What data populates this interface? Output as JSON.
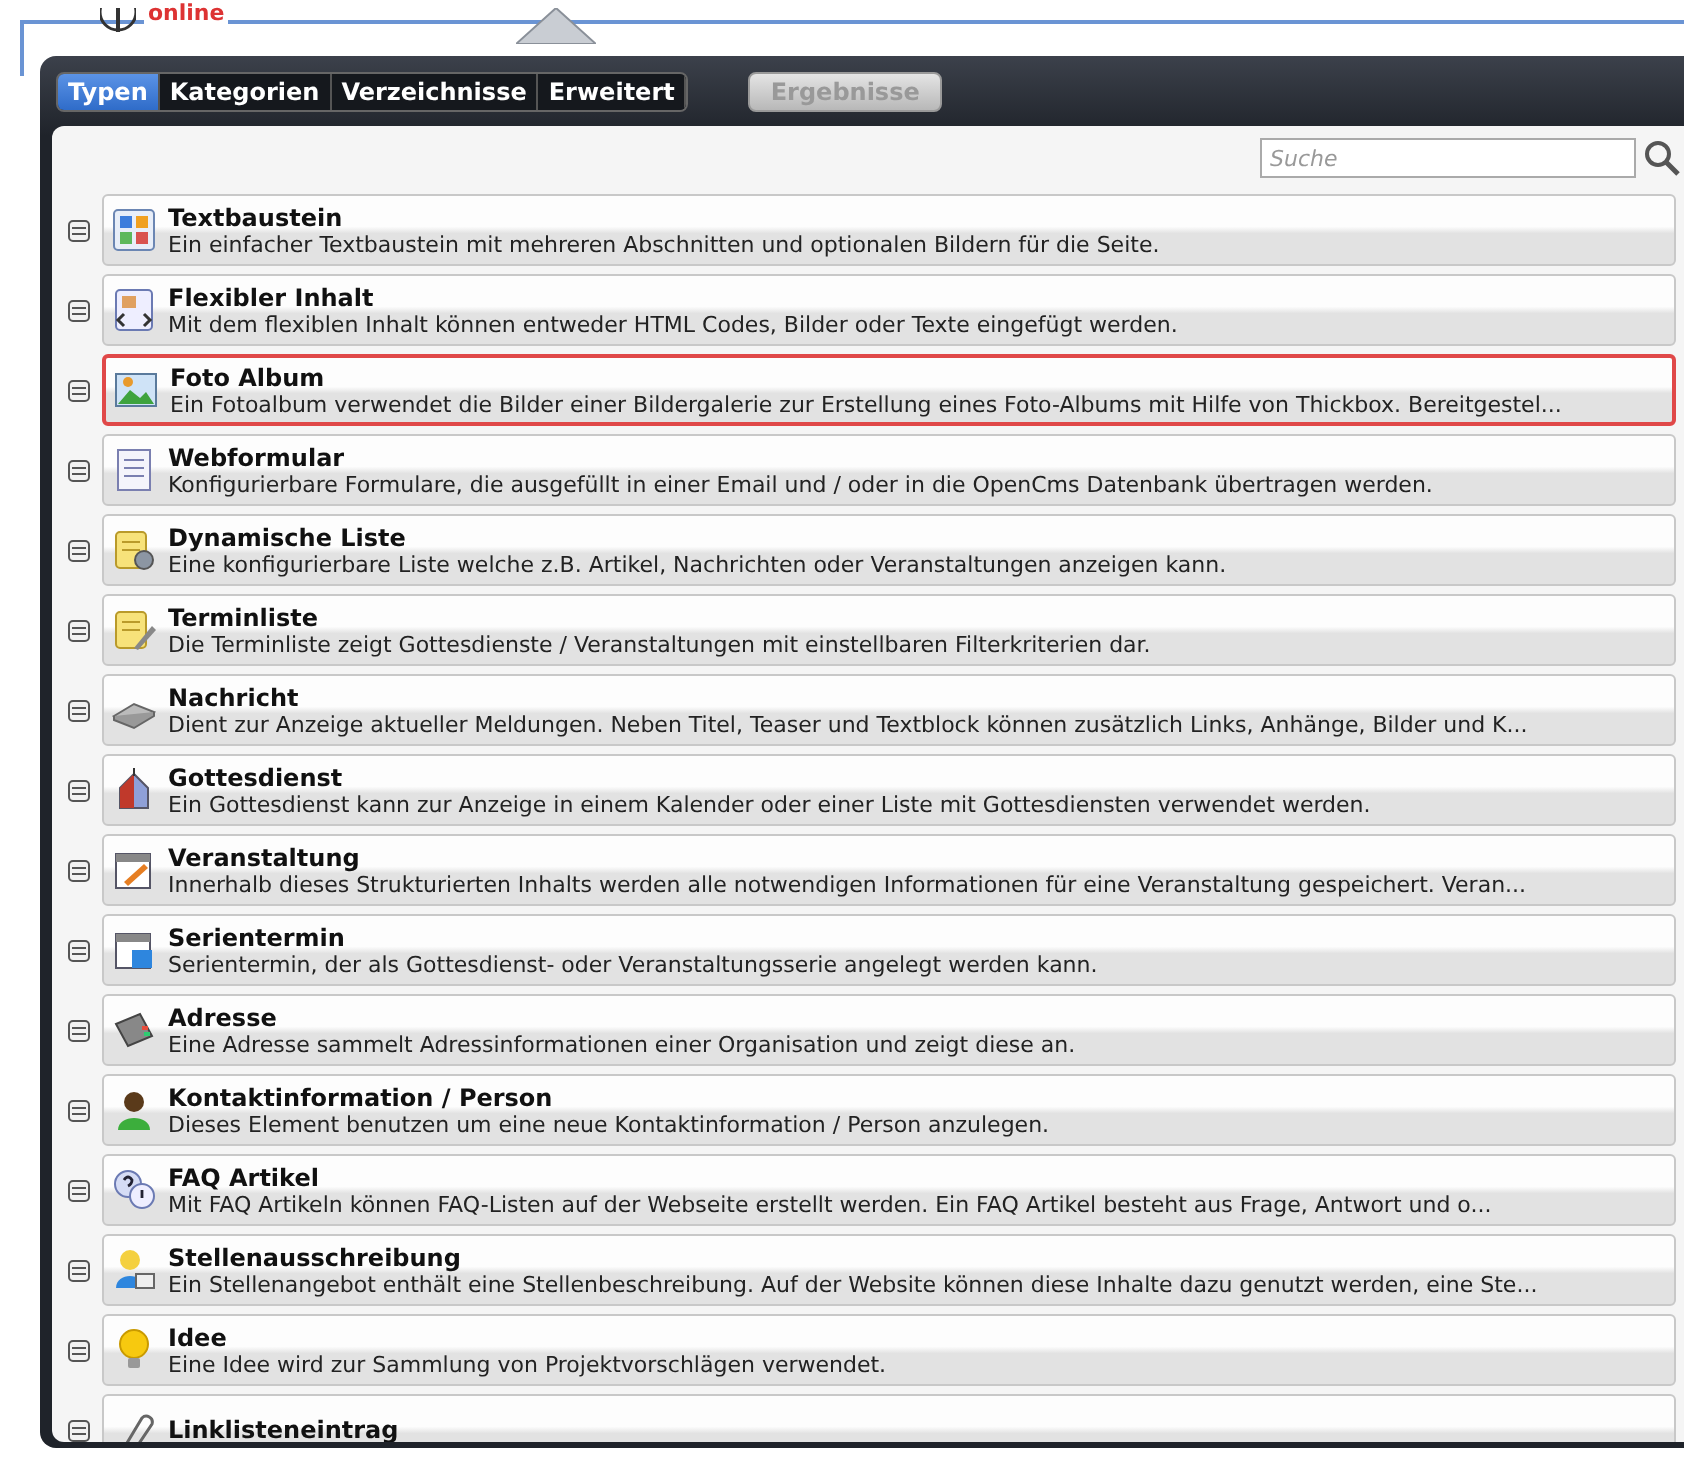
{
  "header": {
    "logo_text": "online"
  },
  "tabs": [
    {
      "label": "Typen",
      "selected": true
    },
    {
      "label": "Kategorien",
      "selected": false
    },
    {
      "label": "Verzeichnisse",
      "selected": false
    },
    {
      "label": "Erweitert",
      "selected": false
    }
  ],
  "results_button": {
    "label": "Ergebnisse",
    "disabled": true
  },
  "search": {
    "placeholder": "Suche"
  },
  "items": [
    {
      "kind": "text",
      "title": "Textbaustein",
      "description": "Ein einfacher Textbaustein mit mehreren Abschnitten und optionalen Bildern für die Seite.",
      "selected": false
    },
    {
      "kind": "flex",
      "title": "Flexibler Inhalt",
      "description": "Mit dem flexiblen Inhalt können entweder HTML Codes, Bilder oder Texte eingefügt werden.",
      "selected": false
    },
    {
      "kind": "photo",
      "title": "Foto Album",
      "description": "Ein Fotoalbum verwendet die Bilder einer Bildergalerie zur Erstellung eines Foto-Albums mit Hilfe von Thickbox. Bereitgestel...",
      "selected": true
    },
    {
      "kind": "form",
      "title": "Webformular",
      "description": "Konfigurierbare Formulare, die ausgefüllt in einer Email und / oder in die OpenCms Datenbank übertragen werden.",
      "selected": false
    },
    {
      "kind": "list",
      "title": "Dynamische Liste",
      "description": "Eine konfigurierbare Liste welche z.B. Artikel, Nachrichten oder Veranstaltungen anzeigen kann.",
      "selected": false
    },
    {
      "kind": "notes",
      "title": "Terminliste",
      "description": "Die Terminliste zeigt Gottesdienste / Veranstaltungen mit einstellbaren Filterkriterien dar.",
      "selected": false
    },
    {
      "kind": "news",
      "title": "Nachricht",
      "description": "Dient zur Anzeige aktueller Meldungen. Neben Titel, Teaser und Textblock können zusätzlich Links, Anhänge, Bilder und K...",
      "selected": false
    },
    {
      "kind": "church",
      "title": "Gottesdienst",
      "description": "Ein Gottesdienst kann zur Anzeige in einem Kalender oder einer Liste mit Gottesdiensten verwendet werden.",
      "selected": false
    },
    {
      "kind": "event",
      "title": "Veranstaltung",
      "description": "Innerhalb dieses Strukturierten Inhalts werden alle notwendigen Informationen für eine Veranstaltung gespeichert. Veran...",
      "selected": false
    },
    {
      "kind": "series",
      "title": "Serientermin",
      "description": "Serientermin, der als Gottesdienst- oder Veranstaltungsserie angelegt werden kann.",
      "selected": false
    },
    {
      "kind": "address",
      "title": "Adresse",
      "description": "Eine Adresse sammelt Adressinformationen einer Organisation und zeigt diese an.",
      "selected": false
    },
    {
      "kind": "person",
      "title": "Kontaktinformation / Person",
      "description": "Dieses Element benutzen um eine neue Kontaktinformation / Person anzulegen.",
      "selected": false
    },
    {
      "kind": "faq",
      "title": "FAQ Artikel",
      "description": "Mit FAQ Artikeln können FAQ-Listen auf der Webseite erstellt werden. Ein FAQ Artikel besteht aus Frage, Antwort und o...",
      "selected": false
    },
    {
      "kind": "job",
      "title": "Stellenausschreibung",
      "description": "Ein Stellenangebot enthält eine Stellenbeschreibung. Auf der Website können diese Inhalte dazu genutzt werden, eine Ste...",
      "selected": false
    },
    {
      "kind": "idea",
      "title": "Idee",
      "description": "Eine Idee wird zur Sammlung von Projektvorschlägen verwendet.",
      "selected": false
    },
    {
      "kind": "link",
      "title": "Linklisteneintrag",
      "selected": false
    }
  ]
}
